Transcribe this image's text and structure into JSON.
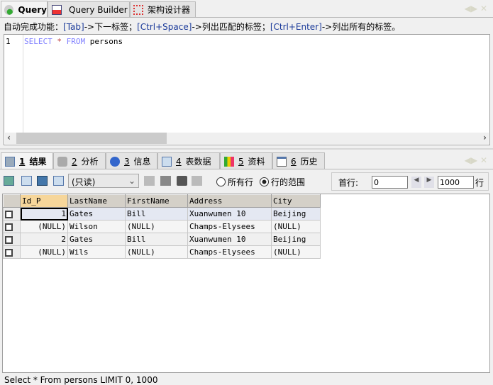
{
  "tabs": [
    {
      "label": "Query",
      "active": true
    },
    {
      "label": "Query Builder"
    },
    {
      "label": "架构设计器"
    }
  ],
  "hint": {
    "prefix": "自动完成功能：",
    "k1": "[Tab]",
    "t1": "->下一标签；",
    "k2": "[Ctrl+Space]",
    "t2": "->列出匹配的标签；",
    "k3": "[Ctrl+Enter]",
    "t3": "->列出所有的标签。"
  },
  "editor": {
    "line_number": "1",
    "kw1": "SELECT",
    "star": "*",
    "kw2": "FROM",
    "ident": "persons",
    "scroll_left": "‹",
    "scroll_right": "›"
  },
  "result_tabs": [
    {
      "num": "1",
      "label": "结果",
      "active": true
    },
    {
      "num": "2",
      "label": "分析"
    },
    {
      "num": "3",
      "label": "信息"
    },
    {
      "num": "4",
      "label": "表数据"
    },
    {
      "num": "5",
      "label": "资料"
    },
    {
      "num": "6",
      "label": "历史"
    }
  ],
  "toolbar": {
    "mode": "(只读)",
    "radio_all": "所有行",
    "radio_range": "行的范围",
    "range_selected": true,
    "first_row_label": "首行:",
    "first_row": "0",
    "count": "1000",
    "rows_label": "行"
  },
  "grid": {
    "columns": [
      "Id_P",
      "LastName",
      "FirstName",
      "Address",
      "City"
    ],
    "rows": [
      [
        "1",
        "Gates",
        "Bill",
        "Xuanwumen 10",
        "Beijing"
      ],
      [
        "(NULL)",
        "Wilson",
        "(NULL)",
        "Champs-Elysees",
        "(NULL)"
      ],
      [
        "2",
        "Gates",
        "Bill",
        "Xuanwumen 10",
        "Beijing"
      ],
      [
        "(NULL)",
        "Wils",
        "(NULL)",
        "Champs-Elysees",
        "(NULL)"
      ]
    ]
  },
  "status": "Select * From persons  LIMIT 0, 1000",
  "colors": {
    "keyword": "#8080ff",
    "text": "#000000",
    "selected_header": "#f6d69a"
  }
}
